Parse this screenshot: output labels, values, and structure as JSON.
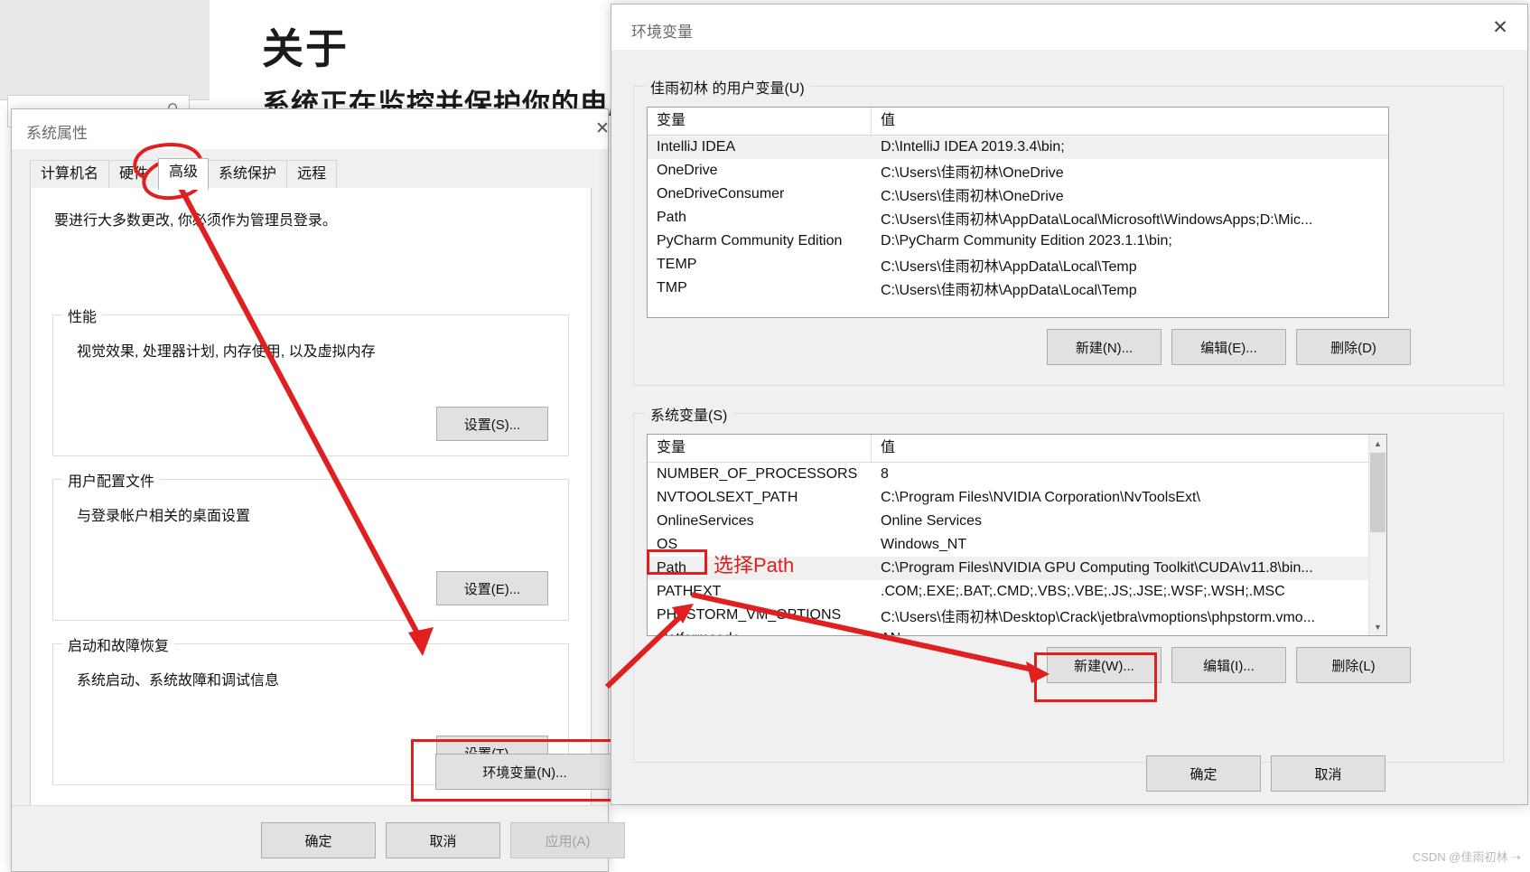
{
  "background": {
    "about_title": "关于",
    "about_subtitle": "系统正在监控并保护你的电脑。",
    "search_icon": "search-icon"
  },
  "sysprops": {
    "title": "系统属性",
    "close_glyph": "✕",
    "tabs": [
      {
        "label": "计算机名",
        "active": false
      },
      {
        "label": "硬件",
        "active": false
      },
      {
        "label": "高级",
        "active": true
      },
      {
        "label": "系统保护",
        "active": false
      },
      {
        "label": "远程",
        "active": false
      }
    ],
    "admin_note": "要进行大多数更改, 你必须作为管理员登录。",
    "groups": [
      {
        "legend": "性能",
        "text": "视觉效果, 处理器计划, 内存使用, 以及虚拟内存",
        "button": "设置(S)..."
      },
      {
        "legend": "用户配置文件",
        "text": "与登录帐户相关的桌面设置",
        "button": "设置(E)..."
      },
      {
        "legend": "启动和故障恢复",
        "text": "系统启动、系统故障和调试信息",
        "button": "设置(T)..."
      }
    ],
    "env_button": "环境变量(N)...",
    "footer": [
      {
        "label": "确定",
        "disabled": false
      },
      {
        "label": "取消",
        "disabled": false
      },
      {
        "label": "应用(A)",
        "disabled": true
      }
    ]
  },
  "envwin": {
    "title": "环境变量",
    "close_glyph": "✕",
    "user_group_legend": "佳雨初林 的用户变量(U)",
    "system_group_legend": "系统变量(S)",
    "columns": {
      "variable": "变量",
      "value": "值"
    },
    "user_rows": [
      {
        "name": "IntelliJ IDEA",
        "value": "D:\\IntelliJ IDEA 2019.3.4\\bin;",
        "selected": true
      },
      {
        "name": "OneDrive",
        "value": "C:\\Users\\佳雨初林\\OneDrive",
        "selected": false
      },
      {
        "name": "OneDriveConsumer",
        "value": "C:\\Users\\佳雨初林\\OneDrive",
        "selected": false
      },
      {
        "name": "Path",
        "value": "C:\\Users\\佳雨初林\\AppData\\Local\\Microsoft\\WindowsApps;D:\\Mic...",
        "selected": false
      },
      {
        "name": "PyCharm Community Edition",
        "value": "D:\\PyCharm Community Edition 2023.1.1\\bin;",
        "selected": false
      },
      {
        "name": "TEMP",
        "value": "C:\\Users\\佳雨初林\\AppData\\Local\\Temp",
        "selected": false
      },
      {
        "name": "TMP",
        "value": "C:\\Users\\佳雨初林\\AppData\\Local\\Temp",
        "selected": false
      }
    ],
    "user_buttons": [
      {
        "label": "新建(N)..."
      },
      {
        "label": "编辑(E)..."
      },
      {
        "label": "删除(D)"
      }
    ],
    "system_rows": [
      {
        "name": "NUMBER_OF_PROCESSORS",
        "value": "8",
        "selected": false
      },
      {
        "name": "NVTOOLSEXT_PATH",
        "value": "C:\\Program Files\\NVIDIA Corporation\\NvToolsExt\\",
        "selected": false
      },
      {
        "name": "OnlineServices",
        "value": "Online Services",
        "selected": false
      },
      {
        "name": "OS",
        "value": "Windows_NT",
        "selected": false
      },
      {
        "name": "Path",
        "value": "C:\\Program Files\\NVIDIA GPU Computing Toolkit\\CUDA\\v11.8\\bin...",
        "selected": true
      },
      {
        "name": "PATHEXT",
        "value": ".COM;.EXE;.BAT;.CMD;.VBS;.VBE;.JS;.JSE;.WSF;.WSH;.MSC",
        "selected": false
      },
      {
        "name": "PHPSTORM_VM_OPTIONS",
        "value": "C:\\Users\\佳雨初林\\Desktop\\Crack\\jetbra\\vmoptions\\phpstorm.vmo...",
        "selected": false
      },
      {
        "name": "platformcode",
        "value": "AN",
        "selected": false
      }
    ],
    "system_buttons": [
      {
        "label": "新建(W)..."
      },
      {
        "label": "编辑(I)..."
      },
      {
        "label": "删除(L)"
      }
    ],
    "footer": [
      {
        "label": "确定"
      },
      {
        "label": "取消"
      }
    ],
    "scroll_up_glyph": "▲",
    "scroll_down_glyph": "▼"
  },
  "annotations": {
    "select_path_label": "选择Path",
    "accent_color": "#e02020"
  },
  "watermark": "CSDN @佳雨初林 ➝"
}
